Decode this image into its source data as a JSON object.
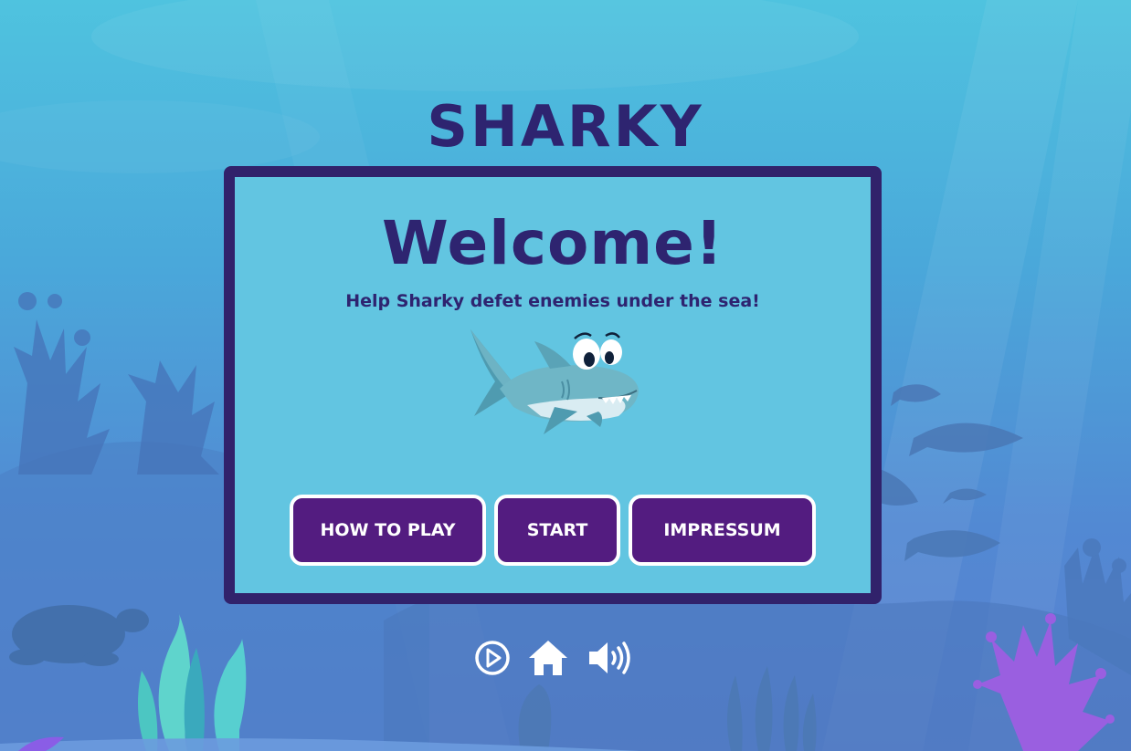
{
  "game": {
    "title": "SHARKY"
  },
  "start_screen": {
    "heading": "Welcome!",
    "subtitle": "Help Sharky defet enemies under the sea!",
    "buttons": {
      "how_to_play": "HOW TO PLAY",
      "start": "START",
      "impressum": "IMPRESSUM"
    }
  },
  "controls": {
    "icons": [
      "play-circle-icon",
      "home-icon",
      "volume-up-icon"
    ]
  },
  "colors": {
    "title": "#2e2470",
    "panel_border": "#31226b",
    "panel_bg": "#62c5e1",
    "button_bg": "#531c80",
    "button_text": "#ffffff"
  }
}
